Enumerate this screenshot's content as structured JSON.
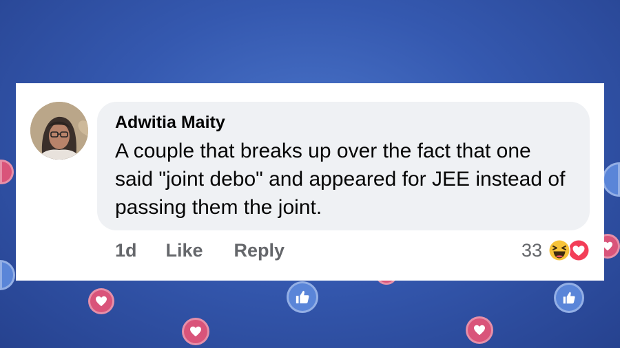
{
  "comment": {
    "author": "Adwitia Maity",
    "text": "A couple that breaks up over the fact that one said \"joint debo\" and appeared for JEE instead of passing them the joint.",
    "avatar_icon": "profile-photo"
  },
  "actions": {
    "time": "1d",
    "like": "Like",
    "reply": "Reply"
  },
  "reactions": {
    "count": "33",
    "icons": [
      "haha-icon",
      "love-icon"
    ]
  },
  "colors": {
    "background": "#3559b0",
    "card": "#ffffff",
    "bubble": "#eff1f4",
    "secondary_text": "#65676b",
    "like_bubble": "#5a85d8",
    "heart_bubble": "#d9547a"
  }
}
